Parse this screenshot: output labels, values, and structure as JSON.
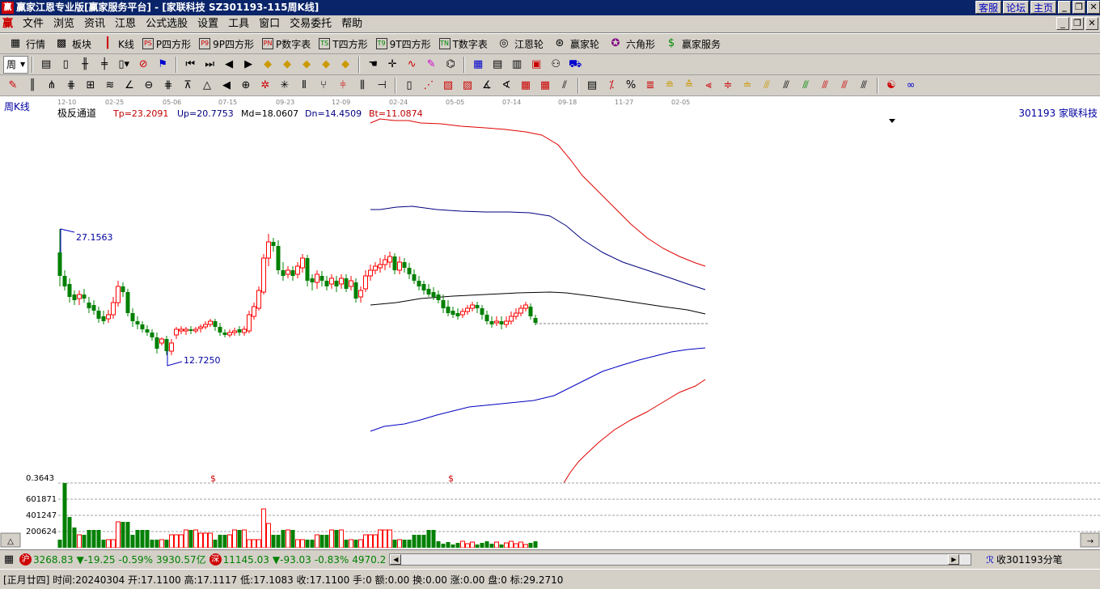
{
  "window": {
    "title": "赢家江恩专业版[赢家服务平台] - [家联科技   SZ301193-115周K线]",
    "top_links": [
      "客服",
      "论坛",
      "主页"
    ]
  },
  "menu": [
    "文件",
    "浏览",
    "资讯",
    "江恩",
    "公式选股",
    "设置",
    "工具",
    "窗口",
    "交易委托",
    "帮助"
  ],
  "toolbar1": [
    {
      "label": "行情",
      "icon": "grid-icon"
    },
    {
      "label": "板块",
      "icon": "blocks-icon"
    },
    {
      "label": "K线",
      "icon": "candle-icon"
    },
    {
      "label": "P四方形",
      "icon": "P"
    },
    {
      "label": "9P四方形",
      "icon": "P9"
    },
    {
      "label": "P数字表",
      "icon": "PN"
    },
    {
      "label": "T四方形",
      "icon": "TS"
    },
    {
      "label": "9T四方形",
      "icon": "T9"
    },
    {
      "label": "T数字表",
      "icon": "TN"
    },
    {
      "label": "江恩轮",
      "icon": "wheel-icon"
    },
    {
      "label": "赢家轮",
      "icon": "wheel2-icon"
    },
    {
      "label": "六角形",
      "icon": "hexagon-icon"
    },
    {
      "label": "赢家服务",
      "icon": "dollar-icon"
    }
  ],
  "toolbar2": {
    "period_label": "周"
  },
  "chart": {
    "period_label": "周K线",
    "indicator_name": "极反通道",
    "tp": "Tp=23.2091",
    "up": "Up=20.7753",
    "md": "Md=18.0607",
    "dn": "Dn=14.4509",
    "bt": "Bt=11.0874",
    "stock_label": "301193 家联科技",
    "high_label": "27.1563",
    "low_label": "12.7250",
    "date_ticks": [
      "12-10",
      "02-25",
      "05-06",
      "07-15",
      "09-23",
      "12-09",
      "02-24",
      "05-05",
      "07-14",
      "09-18",
      "11-27",
      "02-05"
    ],
    "volume_axis": [
      "0.3643",
      "601871",
      "401247",
      "200624"
    ],
    "dividend_marks": [
      "$",
      "$"
    ],
    "colors": {
      "up": "#ff0000",
      "down": "#008000",
      "upper_band": "#e00000",
      "mid_band": "#000080",
      "center": "#000000"
    }
  },
  "chart_data": {
    "type": "candlestick",
    "period": "weekly",
    "y_high": 27.1563,
    "y_low": 12.725,
    "bands": {
      "Tp": 23.2091,
      "Up": 20.7753,
      "Md": 18.0607,
      "Dn": 14.4509,
      "Bt": 11.0874
    },
    "x_ticks": [
      "12-10",
      "02-25",
      "05-06",
      "07-15",
      "09-23",
      "12-09",
      "02-24",
      "05-05",
      "07-14",
      "09-18",
      "11-27",
      "02-05"
    ],
    "volume_ticks": [
      601871,
      401247,
      200624
    ]
  },
  "status": {
    "sh_badge": "沪",
    "sh_index": "3268.83",
    "sh_change": "▼-19.25",
    "sh_pct": "-0.59%",
    "sh_amount": "3930.57亿",
    "sz_badge": "深",
    "sz_index": "11145.03",
    "sz_change": "▼-93.03",
    "sz_pct": "-0.83%",
    "sz_amount": "4970.2",
    "tick_label": "收301193分笔"
  },
  "status2": {
    "text": "[正月廿四] 时间:20240304 开:17.1100 高:17.1117 低:17.1083 收:17.1100 手:0 额:0.00 换:0.00 涨:0.00 盘:0 标:29.2710"
  }
}
